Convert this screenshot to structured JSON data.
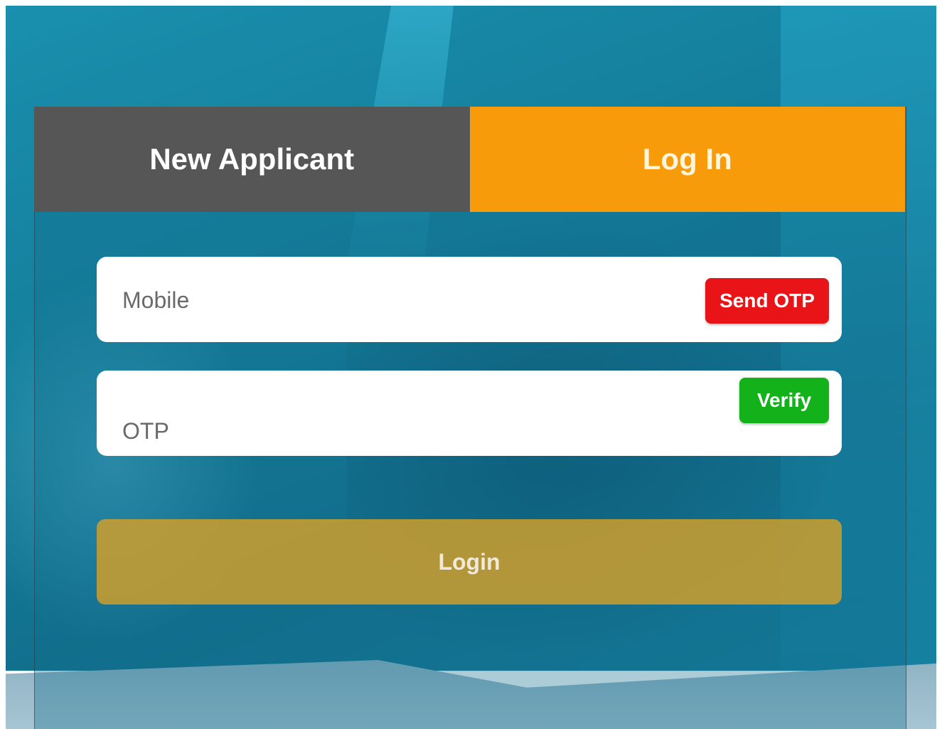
{
  "tabs": {
    "new_applicant": "New Applicant",
    "log_in": "Log In",
    "active": "log_in"
  },
  "form": {
    "mobile_placeholder": "Mobile",
    "mobile_value": "",
    "send_otp_label": "Send OTP",
    "otp_placeholder": "OTP",
    "otp_value": "",
    "verify_label": "Verify",
    "login_label": "Login"
  },
  "colors": {
    "background": "#147f9c",
    "tab_inactive": "#565656",
    "tab_active": "#f89b0a",
    "send_otp": "#e81418",
    "verify": "#13b21b",
    "login_button": "#d6a028"
  }
}
